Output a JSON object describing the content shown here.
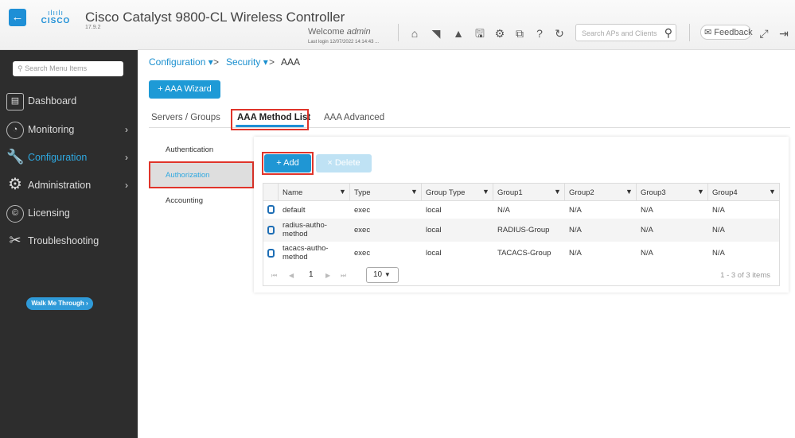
{
  "header": {
    "back_icon": "arrow-left-icon",
    "logo_bars": "ılıılı",
    "logo_word": "CISCO",
    "title": "Cisco Catalyst 9800-CL Wireless Controller",
    "version": "17.9.2",
    "welcome_prefix": "Welcome",
    "user": "admin",
    "last_login": "Last login 12/07/2022 14:14:43 ...",
    "icons": [
      "home-icon",
      "wireless-icon",
      "alert-icon",
      "save-icon",
      "gear-icon",
      "translate-icon",
      "help-icon",
      "refresh-icon"
    ],
    "search_placeholder": "Search APs and Clients",
    "feedback_label": "Feedback",
    "expand_icon": "expand-icon",
    "logout_icon": "logout-icon"
  },
  "sidebar": {
    "search_placeholder": "Search Menu Items",
    "items": [
      {
        "label": "Dashboard",
        "icon": "dashboard-icon",
        "has_children": false,
        "active": false
      },
      {
        "label": "Monitoring",
        "icon": "gauge-icon",
        "has_children": true,
        "active": false
      },
      {
        "label": "Configuration",
        "icon": "wrench-icon",
        "has_children": true,
        "active": true
      },
      {
        "label": "Administration",
        "icon": "gear-icon",
        "has_children": true,
        "active": false
      },
      {
        "label": "Licensing",
        "icon": "license-icon",
        "has_children": false,
        "active": false
      },
      {
        "label": "Troubleshooting",
        "icon": "tools-icon",
        "has_children": false,
        "active": false
      }
    ],
    "walk_me_through": "Walk Me Through ›"
  },
  "breadcrumb": {
    "items": [
      "Configuration",
      "Security",
      "AAA"
    ],
    "separator": ">"
  },
  "wizard_button": "+ AAA Wizard",
  "tabs": [
    {
      "label": "Servers / Groups",
      "active": false
    },
    {
      "label": "AAA Method List",
      "active": true
    },
    {
      "label": "AAA Advanced",
      "active": false
    }
  ],
  "subnav": [
    {
      "label": "Authentication",
      "active": false
    },
    {
      "label": "Authorization",
      "active": true
    },
    {
      "label": "Accounting",
      "active": false
    }
  ],
  "toolbar": {
    "add_label": "+ Add",
    "delete_label": "× Delete"
  },
  "table": {
    "columns": [
      "Name",
      "Type",
      "Group Type",
      "Group1",
      "Group2",
      "Group3",
      "Group4"
    ],
    "rows": [
      {
        "name": "default",
        "type": "exec",
        "group_type": "local",
        "group1": "N/A",
        "group2": "N/A",
        "group3": "N/A",
        "group4": "N/A"
      },
      {
        "name": "radius-autho-method",
        "name_l1": "radius-autho-",
        "name_l2": "method",
        "type": "exec",
        "group_type": "local",
        "group1": "RADIUS-Group",
        "group2": "N/A",
        "group3": "N/A",
        "group4": "N/A"
      },
      {
        "name": "tacacs-autho-method",
        "name_l1": "tacacs-autho-",
        "name_l2": "method",
        "type": "exec",
        "group_type": "local",
        "group1": "TACACS-Group",
        "group2": "N/A",
        "group3": "N/A",
        "group4": "N/A"
      }
    ],
    "pager": {
      "first": "⏮",
      "prev": "◀",
      "page": "1",
      "next": "▶",
      "last": "⏭",
      "page_size": "10",
      "summary": "1 - 3 of 3 items"
    }
  },
  "colors": {
    "accent": "#1e96d4",
    "sidebar_bg": "#2d2d2d",
    "highlight": "#e0342a"
  }
}
